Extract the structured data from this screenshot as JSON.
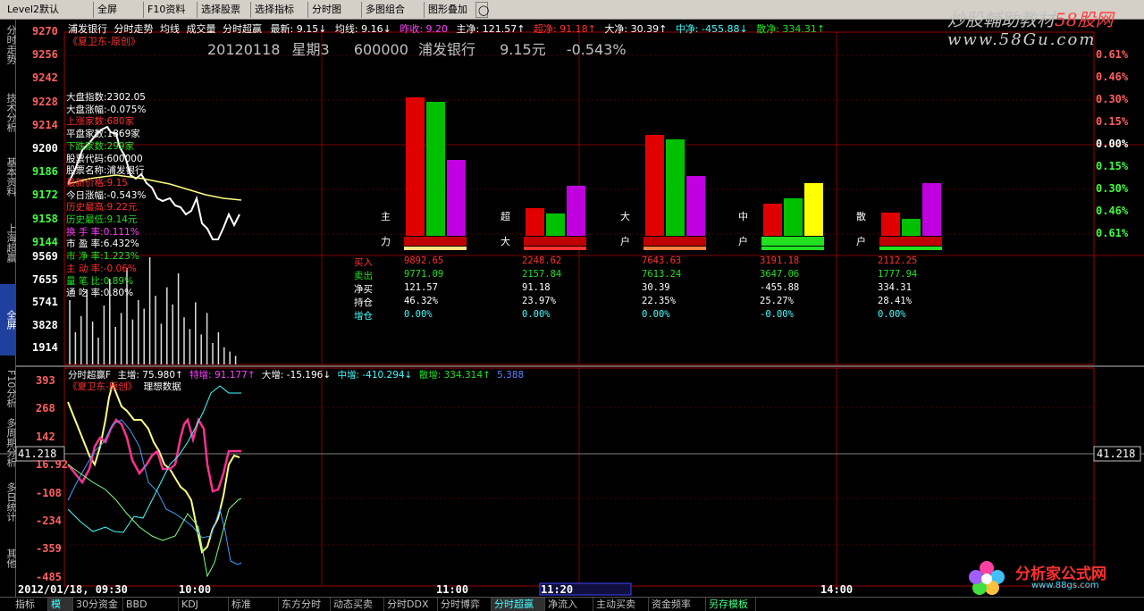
{
  "toolbar": {
    "level2": "Level2默认",
    "fullscreen": "全屏",
    "f10": "F10资料",
    "select_stock": "选择股票",
    "select_indicator": "选择指标",
    "timeline": "分时图",
    "multi": "多图组合",
    "overlay": "图形叠加"
  },
  "watermark": {
    "line1a": "炒股輔助教材",
    "line1b": "58股网",
    "line2": "www.58Gu.com"
  },
  "header_row": {
    "stock": "浦发银行",
    "t1": "分时走势",
    "t2": "均线",
    "t3": "成交量",
    "t4": "分时超赢",
    "latest": "最新: 9.15↓",
    "avg": "均线: 9.16↓",
    "prev": "昨收: 9.20",
    "main": "主净: 121.57↑",
    "super": "超净: 91.18↑",
    "big": "大净: 30.39↑",
    "mid": "中净: -455.88↓",
    "small": "散净: 334.31↑"
  },
  "left_tabs": [
    "分时走势",
    "技术分析",
    "基本资料",
    "上海超赢",
    "全屏",
    "F10分析",
    "多周期分析",
    "多日统计",
    "其他"
  ],
  "sub_label": "《夏卫东-原创》",
  "big_title": {
    "date": "20120118",
    "weekday": "星期3",
    "code": "600000",
    "name": "浦发银行",
    "price": "9.15元",
    "chg": "-0.543%"
  },
  "price_axis": [
    "9270",
    "9256",
    "9242",
    "9228",
    "9214",
    "9200",
    "9186",
    "9172",
    "9158",
    "9144"
  ],
  "pct_axis": [
    "0.61%",
    "0.46%",
    "0.30%",
    "0.15%",
    "0.00%",
    "0.15%",
    "0.30%",
    "0.46%",
    "0.61%"
  ],
  "vol_axis": [
    "9569",
    "7655",
    "5741",
    "3828",
    "1914"
  ],
  "info_panel": [
    {
      "k": "大盘指数:",
      "v": "2302.05",
      "c": "wht"
    },
    {
      "k": "大盘涨幅:",
      "v": "-0.075%",
      "c": "wht"
    },
    {
      "k": "上涨家数:",
      "v": "680家",
      "c": "red"
    },
    {
      "k": "平盘家数:",
      "v": "1869家",
      "c": "wht"
    },
    {
      "k": "下跌家数:",
      "v": "299家",
      "c": "grn"
    },
    {
      "k": "股票代码:",
      "v": "600000",
      "c": "wht"
    },
    {
      "k": "股票名称:",
      "v": "浦发银行",
      "c": "wht"
    },
    {
      "k": "最新价格:",
      "v": "9.15",
      "c": "red"
    },
    {
      "k": "今日涨幅:",
      "v": "-0.543%",
      "c": "wht"
    },
    {
      "k": "历史最高:",
      "v": "9.22元",
      "c": "red"
    },
    {
      "k": "历史最低:",
      "v": "9.14元",
      "c": "grn"
    },
    {
      "k": "换 手 率:",
      "v": "0.111%",
      "c": "mag"
    },
    {
      "k": "市 盈 率:",
      "v": "6.432%",
      "c": "wht"
    },
    {
      "k": "市 净 率:",
      "v": "1.223%",
      "c": "grn"
    },
    {
      "k": "主 动 率:",
      "v": "-0.06%",
      "c": "red"
    },
    {
      "k": "量 笔 比:",
      "v": "0.89%",
      "c": "grn"
    },
    {
      "k": "通 吃 率:",
      "v": "0.80%",
      "c": "wht"
    }
  ],
  "flow_groups": [
    {
      "l1": "主",
      "l2": "力",
      "bars": [
        100,
        97,
        55
      ],
      "colors": [
        "#e00000",
        "#00c000",
        "#c000e0"
      ],
      "base": "#ffe080"
    },
    {
      "l1": "超",
      "l2": "大",
      "bars": [
        20,
        16,
        36
      ],
      "colors": [
        "#e00000",
        "#00c000",
        "#c000e0"
      ],
      "base": "#ff3030"
    },
    {
      "l1": "大",
      "l2": "户",
      "bars": [
        73,
        70,
        43
      ],
      "colors": [
        "#e00000",
        "#00c000",
        "#c000e0"
      ],
      "base": "#ff8040"
    },
    {
      "l1": "中",
      "l2": "户",
      "bars": [
        23,
        27,
        38
      ],
      "colors": [
        "#e00000",
        "#00c000",
        "#ffff00"
      ],
      "base": "#20e020"
    },
    {
      "l1": "散",
      "l2": "户",
      "bars": [
        17,
        12,
        38
      ],
      "colors": [
        "#e00000",
        "#00c000",
        "#c000e0"
      ],
      "base": "#20e020"
    }
  ],
  "flow_table": {
    "rows": [
      {
        "k": "买入",
        "c": "red",
        "v": [
          "9892.65",
          "2248.62",
          "7643.63",
          "3191.18",
          "2112.25"
        ]
      },
      {
        "k": "卖出",
        "c": "grn",
        "v": [
          "9771.09",
          "2157.84",
          "7613.24",
          "3647.06",
          "1777.94"
        ]
      },
      {
        "k": "净买",
        "c": "wht",
        "v": [
          "121.57",
          "91.18",
          "30.39",
          "-455.88",
          "334.31"
        ]
      },
      {
        "k": "持仓",
        "c": "wht",
        "v": [
          "46.32%",
          "23.97%",
          "22.35%",
          "25.27%",
          "28.41%"
        ]
      },
      {
        "k": "增仓",
        "c": "cyn",
        "v": [
          "0.00%",
          "0.00%",
          "0.00%",
          "-0.00%",
          "0.00%"
        ]
      }
    ]
  },
  "lower_header": {
    "name": "分时超赢F",
    "main": "主增: 75.980↑",
    "super": "特增: 91.177↑",
    "big": "大增: -15.196↓",
    "mid": "中增: -410.294↓",
    "small": "散增: 334.314↑",
    "extra": "5.388"
  },
  "lower_sub": "《夏卫东-原创》",
  "lower_sub2": "理想数据",
  "lower_axis": [
    "393",
    "268",
    "142",
    "16.92",
    "-108",
    "-234",
    "-359",
    "-485"
  ],
  "cursor_value": "41.218",
  "time_axis": {
    "start": "2012/01/18, 09:30",
    "t1": "10:00",
    "t2": "11:00",
    "t3": "11:20",
    "t4": "14:00"
  },
  "bottom_tabs": [
    "指标",
    "模板",
    "30分资金",
    "BBD",
    "KDJ",
    "标准",
    "东方分时",
    "动态买卖",
    "分时DDX",
    "分时博弈",
    "分时超赢",
    "净流入",
    "主动买卖",
    "资金频率",
    "另存模板"
  ],
  "logo": {
    "name": "分析家公式网",
    "url": "www.88gs.com"
  },
  "chart_data": {
    "type": "bar",
    "categories": [
      "主力",
      "超大",
      "大户",
      "中户",
      "散户"
    ],
    "series": [
      {
        "name": "买入",
        "values": [
          9892.65,
          2248.62,
          7643.63,
          3191.18,
          2112.25
        ]
      },
      {
        "name": "卖出",
        "values": [
          9771.09,
          2157.84,
          7613.24,
          3647.06,
          1777.94
        ]
      },
      {
        "name": "净买",
        "values": [
          121.57,
          91.18,
          30.39,
          -455.88,
          334.31
        ]
      }
    ]
  }
}
